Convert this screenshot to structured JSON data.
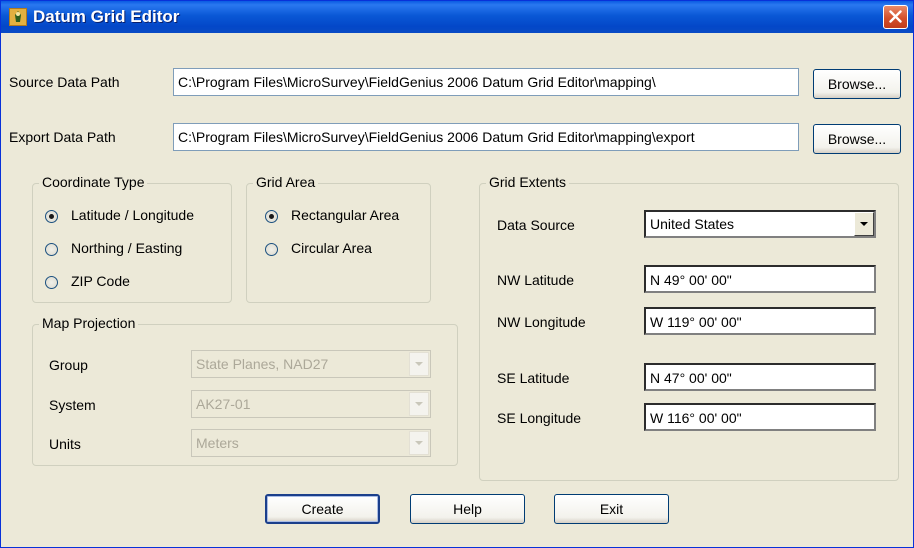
{
  "window": {
    "title": "Datum Grid Editor"
  },
  "paths": {
    "source_label": "Source Data Path",
    "source_value": "C:\\Program Files\\MicroSurvey\\FieldGenius 2006 Datum Grid Editor\\mapping\\",
    "export_label": "Export Data Path",
    "export_value": "C:\\Program Files\\MicroSurvey\\FieldGenius 2006 Datum Grid Editor\\mapping\\export",
    "browse_label": "Browse..."
  },
  "coordinate_type": {
    "title": "Coordinate Type",
    "options": [
      "Latitude / Longitude",
      "Northing / Easting",
      "ZIP Code"
    ],
    "selected": "Latitude / Longitude"
  },
  "grid_area": {
    "title": "Grid Area",
    "options": [
      "Rectangular Area",
      "Circular Area"
    ],
    "selected": "Rectangular Area"
  },
  "map_projection": {
    "title": "Map Projection",
    "group_label": "Group",
    "group_value": "State Planes, NAD27",
    "system_label": "System",
    "system_value": "AK27-01",
    "units_label": "Units",
    "units_value": "Meters"
  },
  "grid_extents": {
    "title": "Grid Extents",
    "data_source_label": "Data Source",
    "data_source_value": "United States",
    "nw_lat_label": "NW Latitude",
    "nw_lat_value": "N 49° 00' 00\"",
    "nw_lon_label": "NW Longitude",
    "nw_lon_value": "W 119° 00' 00\"",
    "se_lat_label": "SE Latitude",
    "se_lat_value": "N 47° 00' 00\"",
    "se_lon_label": "SE Longitude",
    "se_lon_value": "W 116° 00' 00\""
  },
  "buttons": {
    "create": "Create",
    "help": "Help",
    "exit": "Exit"
  },
  "colors": {
    "titlebar": "#0A58D6",
    "dialog_bg": "#ECE9D8",
    "radio_dot": "#21A121",
    "close": "#D4502B"
  }
}
